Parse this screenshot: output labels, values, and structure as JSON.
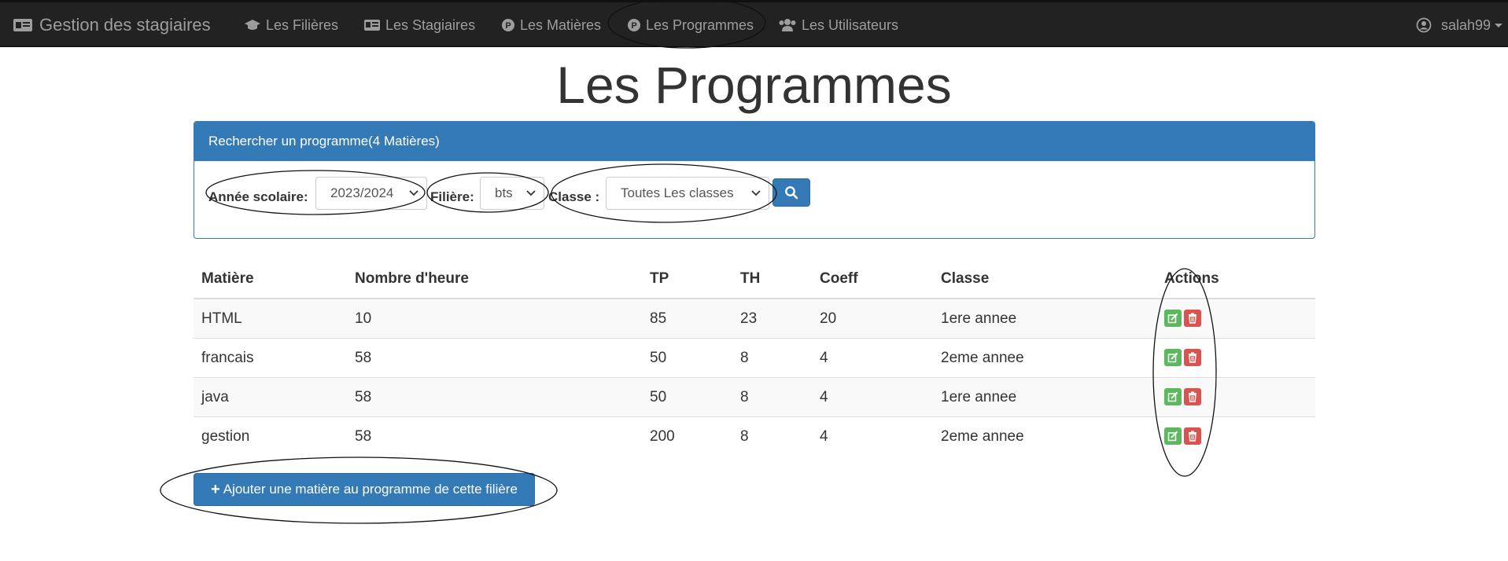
{
  "navbar": {
    "brand": "Gestion des stagiaires",
    "items": [
      {
        "label": "Les Filières",
        "icon": "graduation-cap-icon"
      },
      {
        "label": "Les Stagiaires",
        "icon": "id-card-icon"
      },
      {
        "label": "Les Matières",
        "icon": "p-circle-icon"
      },
      {
        "label": "Les Programmes",
        "icon": "p-circle-icon"
      },
      {
        "label": "Les Utilisateurs",
        "icon": "users-icon"
      }
    ],
    "user": "salah99"
  },
  "page": {
    "title": "Les Programmes"
  },
  "search_panel": {
    "heading": "Rechercher un programme(4 Matières)",
    "annee_label": "Année scolaire:",
    "annee_value": "2023/2024",
    "filiere_label": "Filière:",
    "filiere_value": "bts",
    "classe_label": "Classe :",
    "classe_value": "Toutes Les classes"
  },
  "table": {
    "headers": [
      "Matière",
      "Nombre d'heure",
      "TP",
      "TH",
      "Coeff",
      "Classe",
      "Actions"
    ],
    "rows": [
      [
        "HTML",
        "10",
        "85",
        "23",
        "20",
        "1ere annee"
      ],
      [
        "francais",
        "58",
        "50",
        "8",
        "4",
        "2eme annee"
      ],
      [
        "java",
        "58",
        "50",
        "8",
        "4",
        "1ere annee"
      ],
      [
        "gestion",
        "58",
        "200",
        "8",
        "4",
        "2eme annee"
      ]
    ]
  },
  "add_button": "Ajouter une matière au programme de cette filière",
  "colors": {
    "navbar_bg": "#222222",
    "nav_text": "#9d9d9d",
    "primary": "#337ab7",
    "success": "#5cb85c",
    "danger": "#d9534f"
  }
}
